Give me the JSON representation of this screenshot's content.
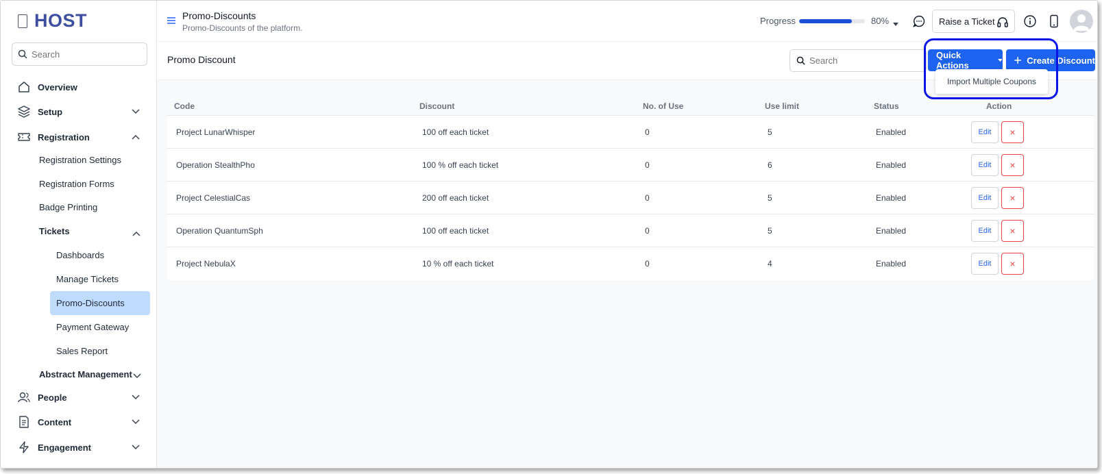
{
  "brand": {
    "logo_text": "HOST"
  },
  "sidebar": {
    "search_placeholder": "Search",
    "items": [
      {
        "label": "Overview",
        "icon": "home-icon"
      },
      {
        "label": "Setup",
        "icon": "layers-icon"
      },
      {
        "label": "Registration",
        "icon": "ticket-icon"
      },
      {
        "label": "People",
        "icon": "people-icon"
      },
      {
        "label": "Content",
        "icon": "document-icon"
      },
      {
        "label": "Engagement",
        "icon": "lightning-icon"
      }
    ],
    "registration_sub": [
      "Registration Settings",
      "Registration Forms",
      "Badge Printing",
      "Tickets"
    ],
    "tickets_sub": [
      "Dashboards",
      "Manage Tickets",
      "Promo-Discounts",
      "Payment Gateway",
      "Sales Report"
    ],
    "abstract_label": "Abstract Management",
    "active_item": "Promo-Discounts"
  },
  "header": {
    "title": "Promo-Discounts",
    "subtitle": "Promo-Discounts of the platform.",
    "progress_label": "Progress",
    "progress_value": 80,
    "progress_text": "80%",
    "raise_ticket_label": "Raise a Ticket"
  },
  "main": {
    "section_title": "Promo Discount",
    "search_placeholder": "Search",
    "quick_actions_label": "Quick Actions",
    "create_label": "Create Discount",
    "dropdown_item": "Import Multiple Coupons",
    "table": {
      "columns": [
        "Code",
        "Discount",
        "No. of Use",
        "Use limit",
        "Status",
        "Action"
      ],
      "rows": [
        {
          "code": "Project LunarWhisper",
          "discount": "100 off each ticket",
          "uses": "0",
          "limit": "5",
          "status": "Enabled"
        },
        {
          "code": "Operation StealthPho",
          "discount": "100 % off each ticket",
          "uses": "0",
          "limit": "6",
          "status": "Enabled"
        },
        {
          "code": "Project CelestialCas",
          "discount": "200 off each ticket",
          "uses": "0",
          "limit": "5",
          "status": "Enabled"
        },
        {
          "code": "Operation QuantumSph",
          "discount": "100 off each ticket",
          "uses": "0",
          "limit": "5",
          "status": "Enabled"
        },
        {
          "code": "Project NebulaX",
          "discount": "10 % off each ticket",
          "uses": "0",
          "limit": "4",
          "status": "Enabled"
        }
      ],
      "edit_label": "Edit",
      "delete_label": "×"
    }
  },
  "colors": {
    "accent": "#1d63f0",
    "brand": "#3f4fa0",
    "highlight": "#0a14e6",
    "danger": "#ef4444",
    "active_bg": "#bfdbfe"
  }
}
